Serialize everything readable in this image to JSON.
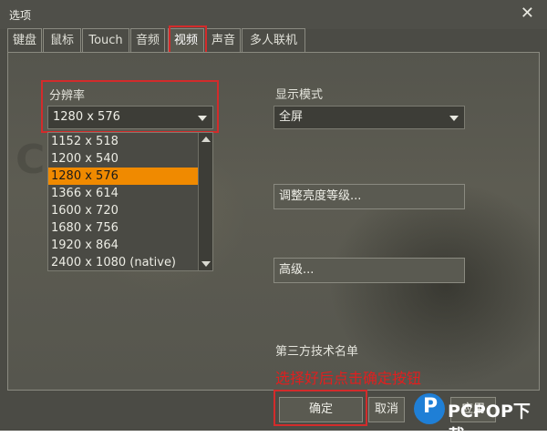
{
  "window": {
    "title": "选项",
    "close_label": "✕"
  },
  "tabs": [
    {
      "label": "键盘"
    },
    {
      "label": "鼠标"
    },
    {
      "label": "Touch"
    },
    {
      "label": "音频"
    },
    {
      "label": "视频",
      "active": true
    },
    {
      "label": "声音"
    },
    {
      "label": "多人联机"
    }
  ],
  "video": {
    "resolution_label": "分辨率",
    "resolution_value": "1280 x 576",
    "resolution_options": [
      "1152 x 518",
      "1200 x 540",
      "1280 x 576",
      "1366 x 614",
      "1600 x 720",
      "1680 x 756",
      "1920 x 864",
      "2400 x 1080 (native)"
    ],
    "resolution_selected": "1280 x 576",
    "display_mode_label": "显示模式",
    "display_mode_value": "全屏",
    "brightness_button": "调整亮度等级...",
    "advanced_button": "高级...",
    "third_party_label": "第三方技术名单"
  },
  "annotation": "选择好后点击确定按钮",
  "footer": {
    "ok": "确定",
    "cancel": "取消",
    "apply": "应用"
  },
  "watermark": {
    "logo_letter": "P",
    "text": "PCPOP下载"
  },
  "colors": {
    "highlight_red": "#d32b2b",
    "selection_orange": "#f08a00",
    "annotation_red": "#e01f1f",
    "watermark_blue": "#1f7fd6"
  }
}
